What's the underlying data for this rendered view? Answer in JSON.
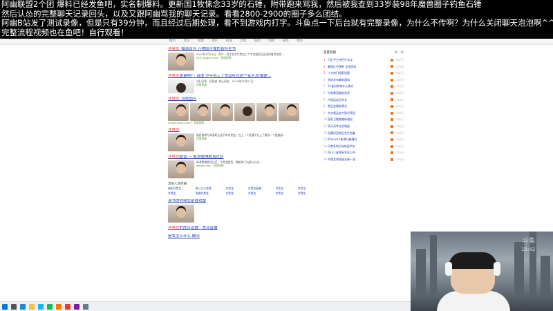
{
  "overlay": {
    "line1": "阿幽联盟2个团  爆料已经发鱼吧，实名制爆料。更新国1牧愫念33岁的石锤，附带跑来骂我，然后被我查到33岁装98年魔兽圈子钓鱼石锤",
    "line2": "然后认怂的完整聊天记录回头，以及又跟阿幽骂我的聊天记录。看看2800-2900的圈子多么团结。",
    "line3": "阿幽B站发了测试录像，但是只有39分钟，而且经过后期处理，看不到游戏内打字。斗鱼点一下后台就有完整录像，为什么不传啊？为什么关闭聊天泡泡啊^^",
    "line4": "完整流程视频也在鱼吧！自行观看！"
  },
  "filters": [
    "网页",
    "资讯",
    "视频",
    "图片",
    "知道",
    "文库",
    "贴吧",
    "地图",
    "采购",
    "更多"
  ],
  "results": [
    {
      "title_prefix": "许昊龙",
      "title_rest": "_赠源百科 万物取可搜的百科全书",
      "snippet": "2019年7月18日 - 简介：男生名字许昊龙三个字在搜索后出现的各种信息...",
      "url": "rich.sougou.com › 百度快照"
    },
    {
      "title_prefix": "许昊龙",
      "title_rest": "是谁啊? - 百度 今年初三了也没听过这个名字,好像是...",
      "snippet": "2条 回答 - 回答者: 热心网友 - 2019年05月21日",
      "url": "百度知道"
    },
    {
      "title_prefix": "许昊龙",
      "title_rest": "_百度图片",
      "snippet": "",
      "url": "image.baidu.com › 百度快照"
    },
    {
      "title_prefix": "许昊龙",
      "title_rest": "",
      "snippet": "曾经被称为网游职业选手的许昊龙，在上一个直播平台上了解到一个重量级...",
      "url": "百度快照"
    },
    {
      "title_prefix": "许昊龙",
      "title_rest": "超话 — 新浪微博超话社区",
      "snippet": "新浪微博超话社区，许昊龙超话，最新热门内容与讨论...",
      "url": "weibo.com › 百度快照"
    }
  ],
  "related": {
    "title": "其他人还在搜",
    "items": [
      "刚刚许昊龙",
      "铁斗太小游戏",
      "许昊龙",
      "许昊龙直播",
      "许昊龙",
      "许昊龙",
      "许昊龙",
      "刚刚许昊龙",
      "许昊龙",
      "许昊龙",
      "许昊龙",
      "许昊龙"
    ]
  },
  "more_results": [
    {
      "title_prefix": "",
      "title_rest": "读书的时候总是喜欢跟"
    },
    {
      "title_prefix": "许昊龙",
      "title_rest": "的虎牙直播 - 虎牙直播"
    },
    {
      "title_prefix": "",
      "title_rest": "是发怎么什么 做问"
    }
  ],
  "hot": {
    "title": "百度热搜",
    "refresh": "换一换",
    "items": [
      {
        "rank": "1",
        "text": "习近平主持召开会议",
        "count": "487万"
      },
      {
        "rank": "2",
        "text": "暴雨红色预警 全国多地",
        "count": "475万"
      },
      {
        "rank": "3",
        "text": "十大热门搜索话题",
        "count": "462万"
      },
      {
        "rank": "4",
        "text": "多地发布最新通知",
        "count": "452万"
      },
      {
        "rank": "5",
        "text": "31省份新增本土确诊",
        "count": "440万"
      },
      {
        "rank": "6",
        "text": "河南暴雨最新消息",
        "count": "428万"
      },
      {
        "rank": "7",
        "text": "中国运动员夺金",
        "count": "416万"
      },
      {
        "rank": "8",
        "text": "奥运会最新赛况",
        "count": "405万"
      },
      {
        "rank": "9",
        "text": "东京奥运会中国代表团",
        "count": "393万"
      },
      {
        "rank": "10",
        "text": "国家卫健委最新通报",
        "count": "381万"
      },
      {
        "rank": "11",
        "text": "明天高考志愿填报",
        "count": "370万"
      },
      {
        "rank": "12",
        "text": "西藏阿里地区发生地震",
        "count": "358万"
      },
      {
        "rank": "13",
        "text": "iPhone13新增功能曝光",
        "count": "346万"
      },
      {
        "rank": "14",
        "text": "河南多地开始恢复供水",
        "count": "335万"
      },
      {
        "rank": "15",
        "text": "四川三星堆新发现公布",
        "count": "323万"
      },
      {
        "rank": "16",
        "text": "中国女排晋级关键一战",
        "count": "311万"
      }
    ]
  },
  "webcam": {
    "watermark": "斗鱼",
    "time": "15:42"
  },
  "taskbar": {
    "icons": [
      "windows-icon",
      "search-icon",
      "edge-icon",
      "explorer-icon",
      "qq-icon",
      "wechat-icon",
      "douyu-icon",
      "music-icon",
      "game-icon",
      "settings-icon"
    ]
  }
}
